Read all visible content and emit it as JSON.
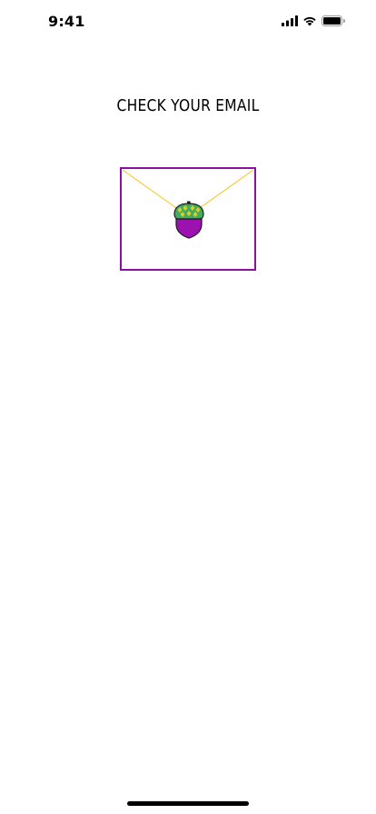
{
  "status_bar": {
    "time": "9:41",
    "icons": [
      "cellular-signal-icon",
      "wifi-icon",
      "battery-icon"
    ]
  },
  "screen": {
    "title": "CHECK YOUR EMAIL"
  },
  "envelope": {
    "icon": "acorn-icon",
    "colors": {
      "border": "#8b10a0",
      "flap": "#f3c417",
      "acorn_cap": "#3fae5e",
      "acorn_cap_pattern": "#e5c928",
      "acorn_body": "#9b12b0"
    }
  }
}
